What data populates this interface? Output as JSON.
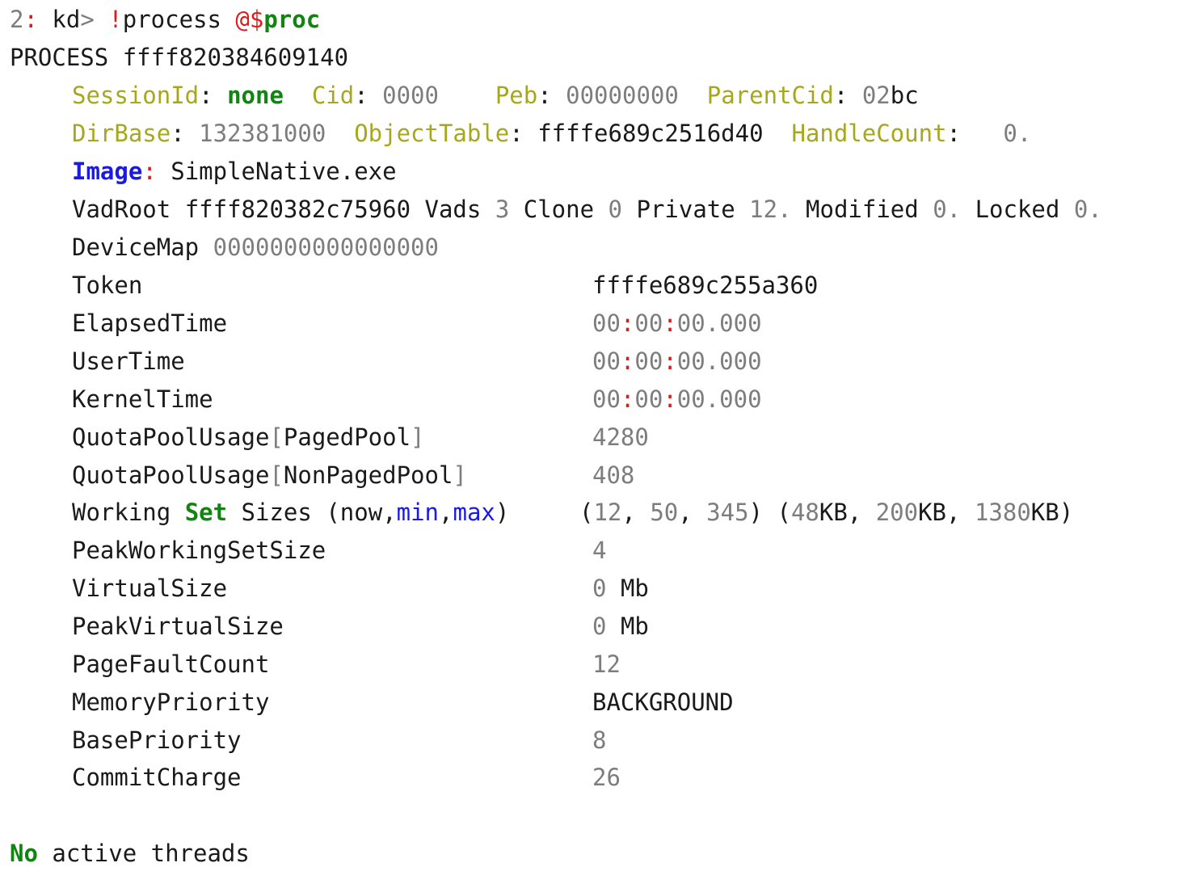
{
  "prompt": {
    "num": "2",
    "colon": ":",
    "kd": "kd",
    "gt": ">",
    "bang": "!",
    "cmd": "process",
    "at": "@$",
    "arg": "proc"
  },
  "process_header": {
    "label": "PROCESS",
    "address": "ffff820384609140"
  },
  "session": {
    "label": "SessionId",
    "value": "none"
  },
  "cid": {
    "label": "Cid",
    "value": "0000"
  },
  "peb": {
    "label": "Peb",
    "value": "00000000"
  },
  "parent_cid": {
    "label": "ParentCid",
    "value_digits": "02",
    "value_letters": "bc"
  },
  "dirbase": {
    "label": "DirBase",
    "value": "132381000"
  },
  "object_table": {
    "label": "ObjectTable",
    "value": "ffffe689c2516d40"
  },
  "handle_count": {
    "label": "HandleCount",
    "value": "0."
  },
  "image": {
    "label": "Image",
    "value": "SimpleNative.exe"
  },
  "vad": {
    "vadroot_label": "VadRoot",
    "vadroot_value": "ffff820382c75960",
    "vads_label": "Vads",
    "vads_value": "3",
    "clone_label": "Clone",
    "clone_value": "0",
    "private_label": "Private",
    "private_value": "12.",
    "modified_label": "Modified",
    "modified_value": "0.",
    "locked_label": "Locked",
    "locked_value": "0."
  },
  "device_map": {
    "label": "DeviceMap",
    "value": "0000000000000000"
  },
  "token": {
    "label": "Token",
    "value": "ffffe689c255a360"
  },
  "times": [
    {
      "label": "ElapsedTime",
      "h": "00",
      "m": "00",
      "s": "00.000"
    },
    {
      "label": "UserTime",
      "h": "00",
      "m": "00",
      "s": "00.000"
    },
    {
      "label": "KernelTime",
      "h": "00",
      "m": "00",
      "s": "00.000"
    }
  ],
  "quota_paged": {
    "label": "QuotaPoolUsage",
    "pool": "PagedPool",
    "value": "4280"
  },
  "quota_nonpaged": {
    "label": "QuotaPoolUsage",
    "pool": "NonPagedPool",
    "value": "408"
  },
  "working_set": {
    "label_working": "Working",
    "label_set": "Set",
    "label_sizes": "Sizes",
    "label_now": "now",
    "label_min": "min",
    "label_max": "max",
    "now": "12",
    "min": "50",
    "max": "345",
    "now_kb": "48",
    "min_kb": "200",
    "max_kb": "1380",
    "unit": "KB"
  },
  "peak_ws": {
    "label": "PeakWorkingSetSize",
    "value": "4"
  },
  "virtual_size": {
    "label": "VirtualSize",
    "value": "0",
    "unit": "Mb"
  },
  "peak_virtual_size": {
    "label": "PeakVirtualSize",
    "value": "0",
    "unit": "Mb"
  },
  "page_fault": {
    "label": "PageFaultCount",
    "value": "12"
  },
  "memory_priority": {
    "label": "MemoryPriority",
    "value": "BACKGROUND"
  },
  "base_priority": {
    "label": "BasePriority",
    "value": "8"
  },
  "commit_charge": {
    "label": "CommitCharge",
    "value": "26"
  },
  "threads": {
    "no": "No",
    "rest": "active threads"
  }
}
